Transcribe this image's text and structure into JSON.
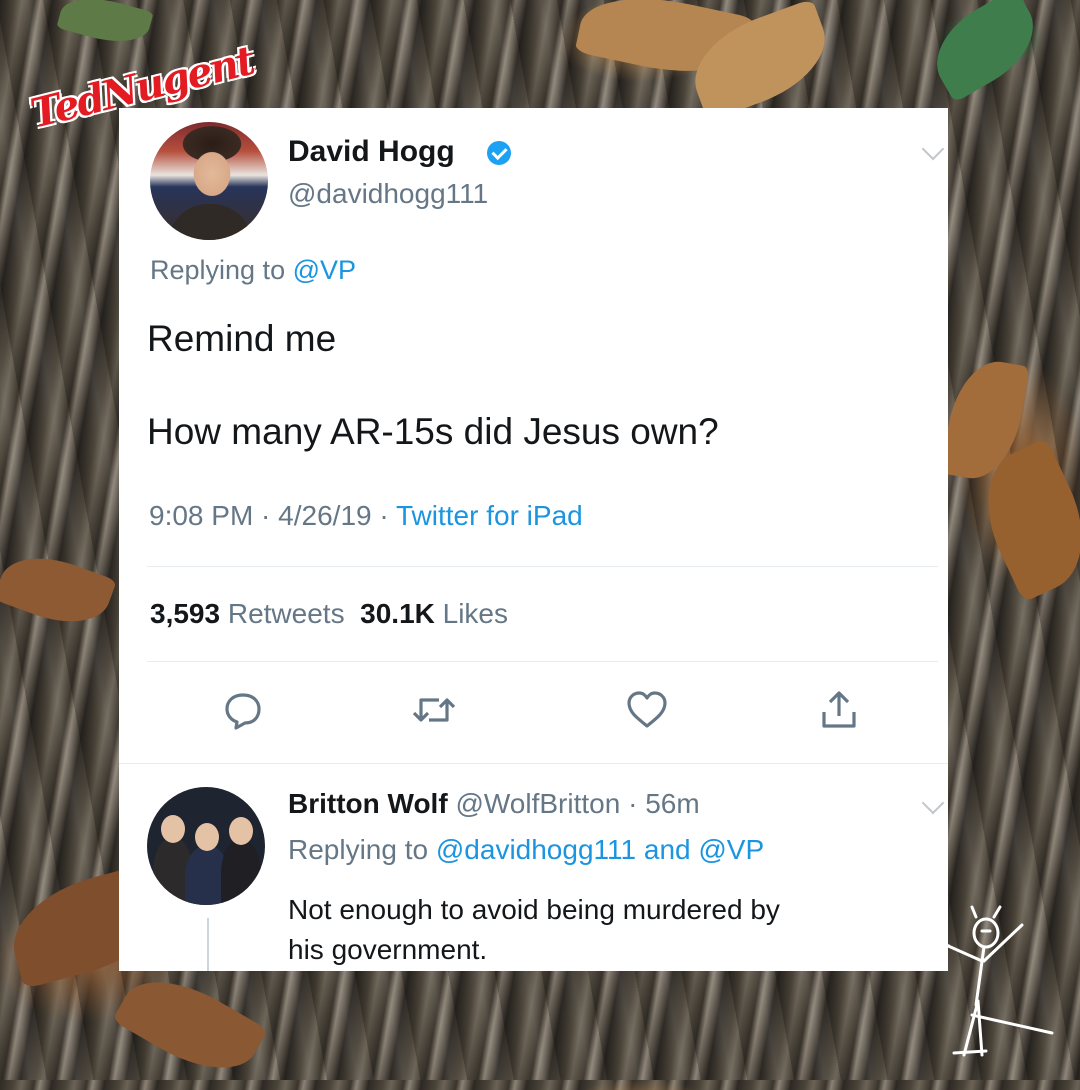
{
  "brand": {
    "logo_text": "TedNugent"
  },
  "tweet": {
    "author_name": "David Hogg",
    "author_handle": "@davidhogg111",
    "verified": true,
    "replying_prefix": "Replying to ",
    "replying_to": "@VP",
    "text_line1": "Remind me",
    "text_line2": "How many AR-15s did Jesus own?",
    "time": "9:08 PM",
    "date": "4/26/19",
    "separator": " · ",
    "source": "Twitter for iPad",
    "retweets_count": "3,593",
    "retweets_label": "Retweets",
    "likes_count": "30.1K",
    "likes_label": "Likes",
    "actions": [
      "reply-icon",
      "retweet-icon",
      "like-icon",
      "share-icon"
    ]
  },
  "reply": {
    "author_name": "Britton Wolf",
    "author_handle": "@WolfBritton",
    "separator": " · ",
    "age": "56m",
    "replying_prefix": "Replying to ",
    "replying_to_1": "@davidhogg111",
    "replying_and": " and ",
    "replying_to_2": "@VP",
    "text_line1": "Not enough to avoid being murdered by",
    "text_line2": "his government."
  },
  "colors": {
    "accent": "#1da1f2",
    "link": "#1b95e0",
    "muted": "#657786",
    "logo_red": "#e31b23"
  }
}
